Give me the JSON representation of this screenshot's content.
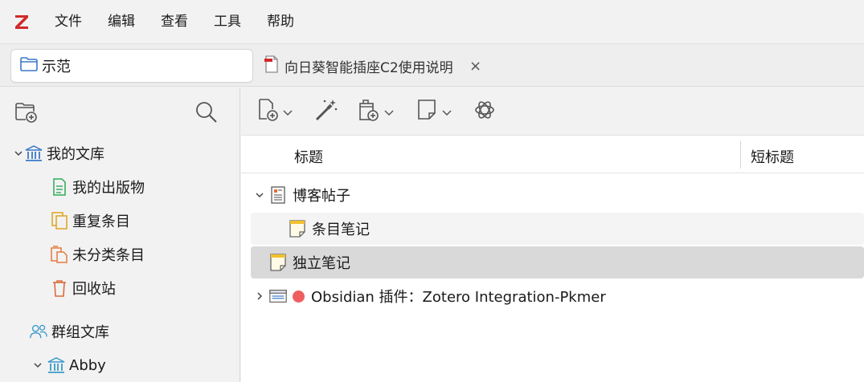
{
  "menu": {
    "items": [
      "文件",
      "编辑",
      "查看",
      "工具",
      "帮助"
    ]
  },
  "tabs": {
    "library_tab_label": "示范",
    "reader_tab_label": "向日葵智能插座C2使用说明",
    "reader_close": "×"
  },
  "sidebar": {
    "my_library": "我的文库",
    "items": [
      {
        "label": "我的出版物"
      },
      {
        "label": "重复条目"
      },
      {
        "label": "未分类条目"
      },
      {
        "label": "回收站"
      }
    ],
    "group_libraries": "群组文库",
    "group_abby": "Abby"
  },
  "columns": {
    "title": "标题",
    "short_title": "短标题"
  },
  "items": {
    "blog_post": "博客帖子",
    "item_note": "条目笔记",
    "standalone_note": "独立笔记",
    "obsidian_item": "Obsidian 插件：Zotero Integration-Pkmer"
  },
  "colors": {
    "zotero_red": "#d12a2a",
    "folder_blue": "#3a78c9",
    "library_blue": "#3a78c9",
    "publications_green": "#2eaa5a",
    "duplicates_amber": "#e0a31c",
    "unfiled_orange": "#e77a3d",
    "trash_orange": "#d96b3b",
    "note_yellow": "#f2c12e",
    "status_red": "#ee5e5e"
  },
  "icons": {
    "logo": "zotero-z-icon",
    "new_collection": "new-collection-icon",
    "search": "search-icon",
    "new_item": "new-item-icon",
    "magic_wand": "add-by-identifier-icon",
    "new_attachment": "add-attachment-icon",
    "new_note": "new-note-icon",
    "ai": "openai-icon"
  }
}
